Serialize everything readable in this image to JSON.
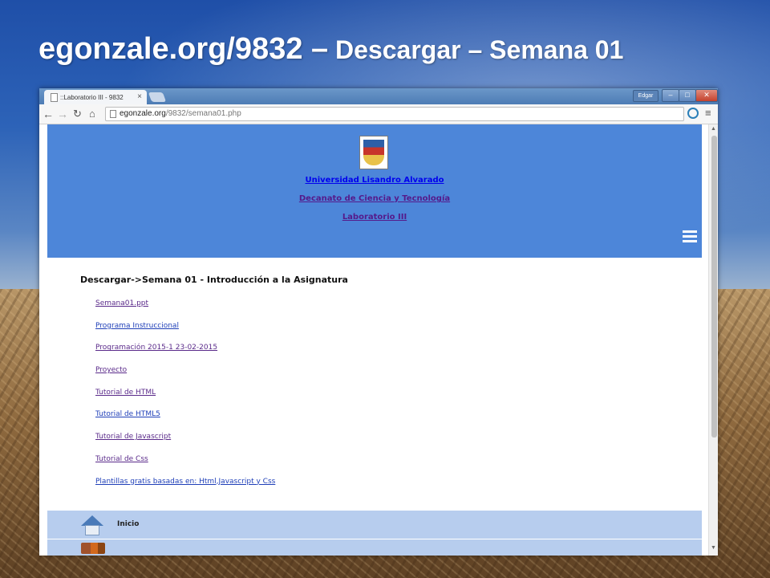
{
  "slide": {
    "title_main": "egonzale.org/9832 –",
    "title_rest": " Descargar – Semana 01"
  },
  "browser": {
    "tab_title": "::Laboratorio III - 9832",
    "tab_close": "×",
    "user_button": "Edgar",
    "url_host": "egonzale.org",
    "url_path": "/9832/semana01.php",
    "icons": [
      "back-arrow-icon",
      "forward-arrow-icon",
      "reload-icon",
      "home-icon",
      "star-icon",
      "extension-icon",
      "menu-icon"
    ]
  },
  "header": {
    "links": [
      "Universidad Lisandro Alvarado",
      "Decanato de Ciencia y Tecnología",
      "Laboratorio III"
    ]
  },
  "content": {
    "title": "Descargar->Semana 01 - Introducción a la Asignatura",
    "links": [
      "Semana01.ppt",
      "Programa Instruccional",
      "Programación 2015-1 23-02-2015",
      "Proyecto",
      "Tutorial de HTML",
      "Tutorial de HTML5",
      "Tutorial de Javascript",
      "Tutorial de Css",
      "Plantillas gratis basadas en: Html,Javascript y Css"
    ]
  },
  "bottom_nav": {
    "items": [
      "Inicio"
    ]
  },
  "colors": {
    "header_bg": "#4d86d9",
    "nav_bg": "#b7cdee",
    "link": "#1f3fb8",
    "visited_link": "#5a2a8a"
  }
}
